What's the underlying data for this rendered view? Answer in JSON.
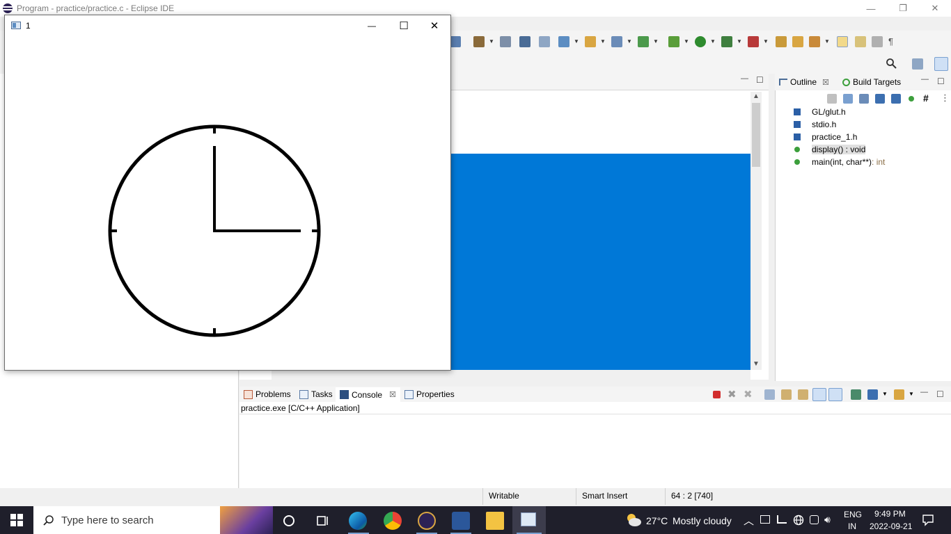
{
  "eclipse": {
    "title": "Program - practice/practice.c - Eclipse IDE",
    "controls": {
      "minimize": "—",
      "restore": "❐",
      "close": "✕"
    }
  },
  "glut_window": {
    "title": "1",
    "controls": {
      "minimize": "—",
      "maximize": "☐",
      "close": "✕"
    }
  },
  "clock": {
    "hour_hand_points_to": 3,
    "minute_hand_points_to": 12,
    "tick_marks_at": [
      12,
      3,
      6,
      9
    ],
    "color": "#000000"
  },
  "outline": {
    "tabs": [
      {
        "label": "Outline",
        "close": "☒"
      },
      {
        "label": "Build Targets"
      }
    ],
    "items": [
      {
        "label": "GL/glut.h",
        "kind": "include"
      },
      {
        "label": "stdio.h",
        "kind": "include"
      },
      {
        "label": "practice_1.h",
        "kind": "include"
      },
      {
        "label": "display() : void",
        "kind": "function",
        "selected": true
      },
      {
        "label": "main(int, char**)",
        "return_type": " : int",
        "kind": "function"
      }
    ]
  },
  "console": {
    "tabs": [
      {
        "label": "Problems"
      },
      {
        "label": "Tasks"
      },
      {
        "label": "Console",
        "active": true,
        "close": "☒"
      },
      {
        "label": "Properties"
      }
    ],
    "header": "practice.exe [C/C++ Application]"
  },
  "statusbar": {
    "writable": "Writable",
    "insert_mode": "Smart Insert",
    "position": "64 : 2 [740]"
  },
  "taskbar": {
    "search_placeholder": "Type here to search",
    "weather_temp": "27°C",
    "weather_desc": "Mostly cloudy",
    "language_top": "ENG",
    "language_bottom": "IN",
    "time": "9:49 PM",
    "date": "2022-09-21"
  },
  "colors": {
    "selection": "#0078d7",
    "taskbar": "#1f1f2b",
    "include_icon": "#2b5fa6",
    "function_icon": "#3c9f3c"
  }
}
